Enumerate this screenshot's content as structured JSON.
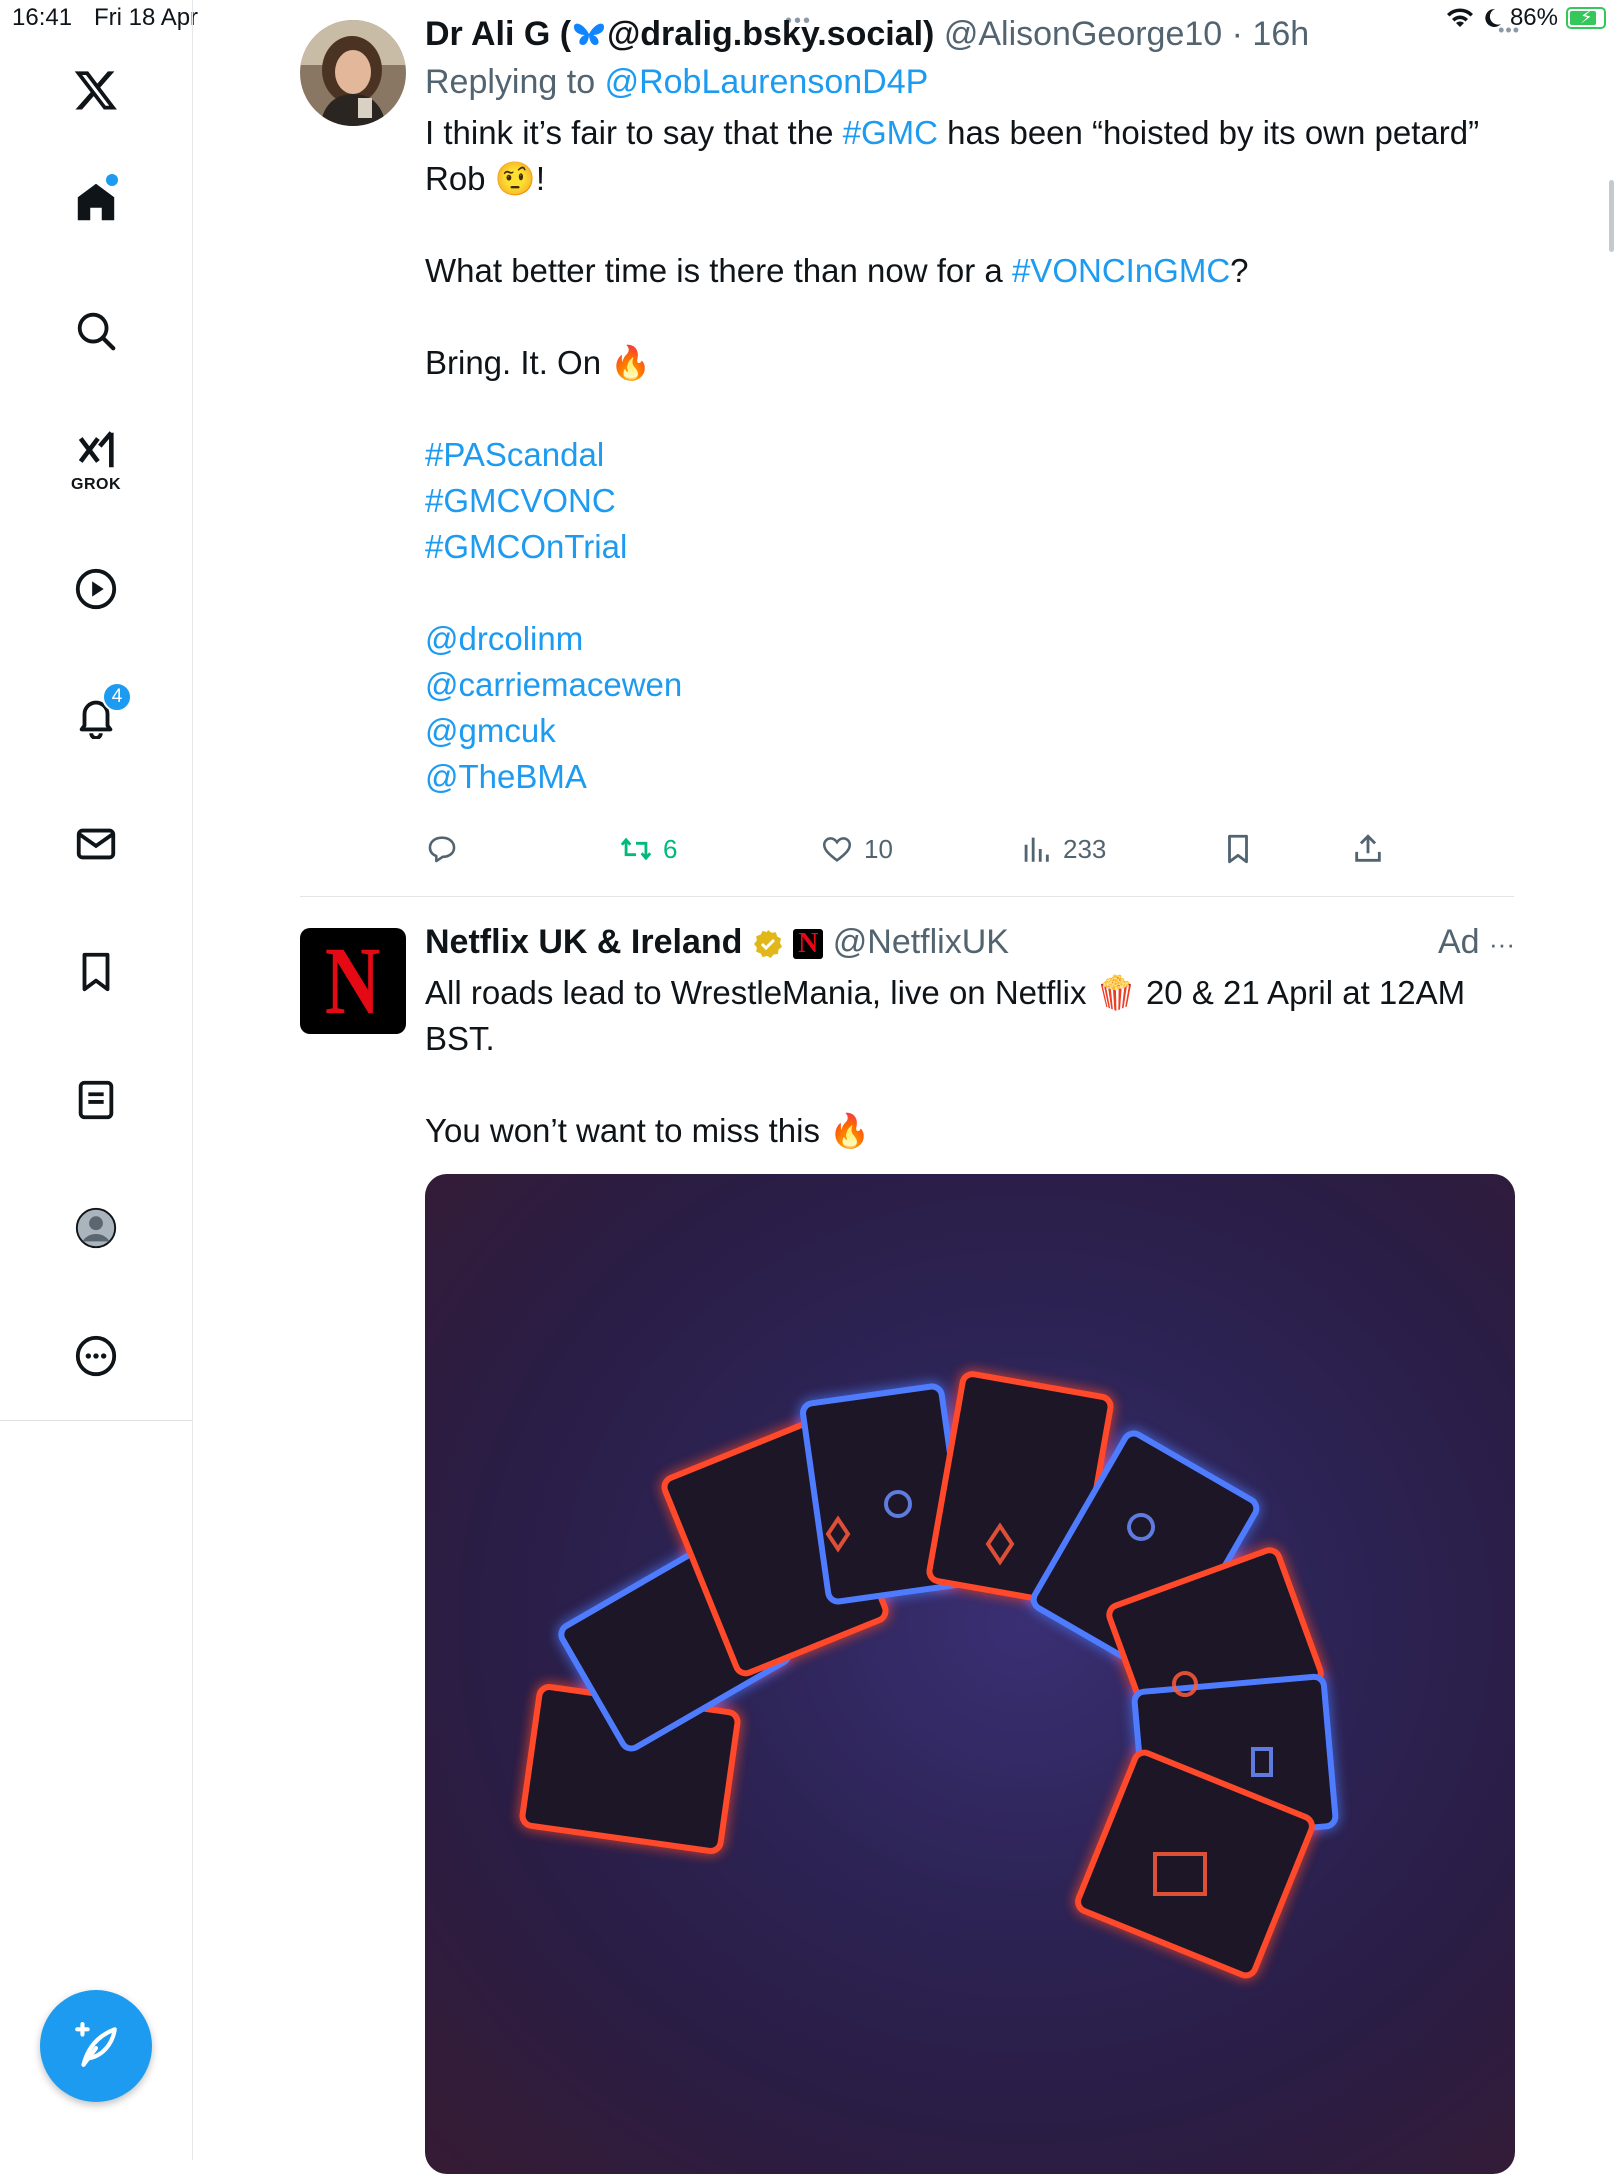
{
  "status_bar": {
    "time": "16:41",
    "date": "Fri 18 Apr",
    "battery": "86%",
    "battery_level": 0.86
  },
  "sidebar": {
    "items": [
      {
        "name": "home",
        "icon": "home-icon"
      },
      {
        "name": "explore",
        "icon": "search-icon"
      },
      {
        "name": "grok",
        "icon": "grok-icon",
        "label": "GROK"
      },
      {
        "name": "videos",
        "icon": "play-icon"
      },
      {
        "name": "notifications",
        "icon": "bell-icon",
        "badge": "4"
      },
      {
        "name": "messages",
        "icon": "mail-icon"
      },
      {
        "name": "bookmarks",
        "icon": "bookmark-icon"
      },
      {
        "name": "lists",
        "icon": "list-icon"
      },
      {
        "name": "profile",
        "icon": "avatar"
      },
      {
        "name": "more",
        "icon": "more-icon"
      }
    ],
    "compose_icon": "compose-icon"
  },
  "tweet1": {
    "display_name": "Dr Ali G (",
    "bsky_handle": "@dralig.bsky.social)",
    "handle": "@AlisonGeorge10",
    "separator": "·",
    "time": "16h",
    "replying_prefix": "Replying to",
    "replying_to": "@RobLaurensonD4P",
    "line1_a": "I think it’s fair to say that the ",
    "line1_tag": "#GMC",
    "line1_b": " has been  “hoisted by its own petard” Rob ",
    "line1_emoji": "🤨",
    "line1_end": "!",
    "line2_a": "What better time is there than now for a ",
    "line2_tag": "#VONCInGMC",
    "line2_end": "?",
    "line3": "Bring. It. On ",
    "fire": "🔥",
    "hashtags": [
      "#PAScandal",
      "#GMCVONC",
      "#GMCOnTrial"
    ],
    "mentions": [
      "@drcolinm",
      "@carriemacewen",
      "@gmcuk",
      "@TheBMA"
    ],
    "actions": {
      "replies": "",
      "retweets": "6",
      "likes": "10",
      "views": "233"
    },
    "retweet_color": "#00ba7c"
  },
  "tweet2": {
    "display_name": "Netflix UK & Ireland",
    "handle": "@NetflixUK",
    "ad_label": "Ad",
    "more": "···",
    "text_a": "All roads lead to WrestleMania, live on Netflix ",
    "popcorn": "🍿",
    "text_b": " 20 & 21 April at 12AM BST.",
    "text2": "You won’t want to miss this ",
    "fire": "🔥",
    "logo_letter": "N"
  },
  "colors": {
    "accent": "#1d9bf0",
    "text": "#0f1419",
    "muted": "#536471",
    "netflix_red": "#e50914"
  }
}
